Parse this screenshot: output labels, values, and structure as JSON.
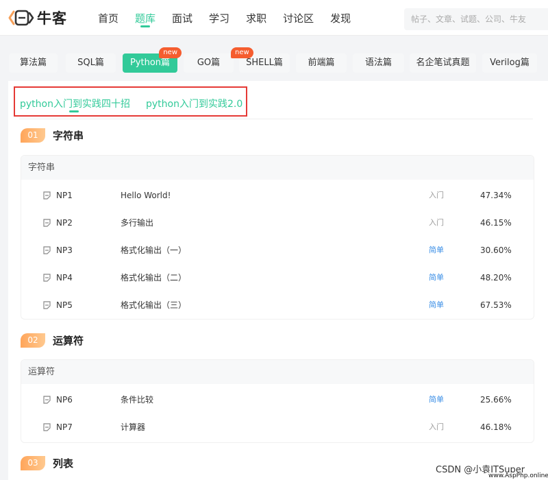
{
  "brand": {
    "name": "牛客"
  },
  "nav": {
    "items": [
      "首页",
      "题库",
      "面试",
      "学习",
      "求职",
      "讨论区",
      "发现"
    ],
    "active_index": 1
  },
  "search": {
    "placeholder": "帖子、文章、试题、公司、牛友"
  },
  "categories": [
    {
      "label": "算法篇",
      "active": false,
      "badge": ""
    },
    {
      "label": "SQL篇",
      "active": false,
      "badge": ""
    },
    {
      "label": "Python篇",
      "active": true,
      "badge": "new"
    },
    {
      "label": "GO篇",
      "active": false,
      "badge": ""
    },
    {
      "label": "SHELL篇",
      "active": false,
      "badge": "new"
    },
    {
      "label": "前端篇",
      "active": false,
      "badge": ""
    },
    {
      "label": "语法篇",
      "active": false,
      "badge": ""
    },
    {
      "label": "名企笔试真题",
      "active": false,
      "badge": ""
    },
    {
      "label": "Verilog篇",
      "active": false,
      "badge": ""
    }
  ],
  "subtabs": [
    "python入门到实践四十招",
    "python入门到实践2.0"
  ],
  "sections": [
    {
      "num": "01",
      "title": "字符串",
      "group": "字符串",
      "rows": [
        {
          "id": "NP1",
          "title": "Hello World!",
          "difficulty": "入门",
          "rate": "47.34%"
        },
        {
          "id": "NP2",
          "title": "多行输出",
          "difficulty": "入门",
          "rate": "46.15%"
        },
        {
          "id": "NP3",
          "title": "格式化输出（一）",
          "difficulty": "简单",
          "rate": "30.60%"
        },
        {
          "id": "NP4",
          "title": "格式化输出（二）",
          "difficulty": "简单",
          "rate": "48.20%"
        },
        {
          "id": "NP5",
          "title": "格式化输出（三）",
          "difficulty": "简单",
          "rate": "67.53%"
        }
      ]
    },
    {
      "num": "02",
      "title": "运算符",
      "group": "运算符",
      "rows": [
        {
          "id": "NP6",
          "title": "条件比较",
          "difficulty": "简单",
          "rate": "25.66%"
        },
        {
          "id": "NP7",
          "title": "计算器",
          "difficulty": "入门",
          "rate": "46.18%"
        }
      ]
    },
    {
      "num": "03",
      "title": "列表",
      "group": "",
      "rows": []
    }
  ],
  "watermark": {
    "text": "CSDN @小袁ITSuper",
    "small": "www.AspPhp.online"
  },
  "colors": {
    "accent": "#32ca99",
    "badge": "#f55d2f",
    "easy": "#3a8ee6",
    "highlight_box": "#e53935",
    "section_num": "#ffa55a"
  }
}
